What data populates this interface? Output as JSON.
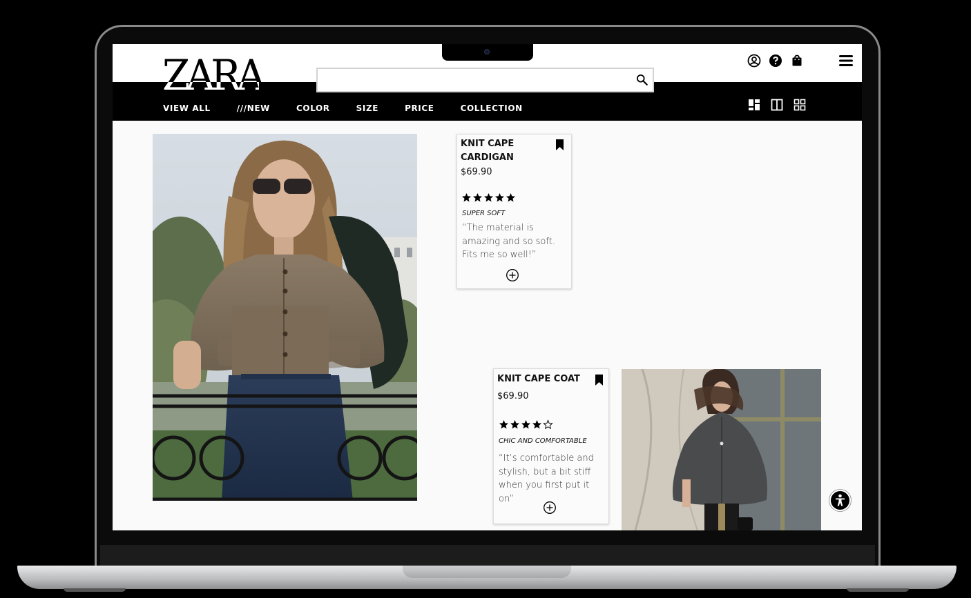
{
  "brand": {
    "logo_text": "ZARA"
  },
  "search": {
    "placeholder": "",
    "value": "",
    "icon": "search-icon"
  },
  "header_icons": [
    "account-icon",
    "help-icon",
    "shopping-bag-icon",
    "menu-icon"
  ],
  "nav": {
    "links": [
      "VIEW ALL",
      "///NEW",
      "COLOR",
      "SIZE",
      "PRICE",
      "COLLECTION"
    ],
    "view_modes": [
      "mosaic-view-icon",
      "two-column-view-icon",
      "grid-view-icon"
    ]
  },
  "products": [
    {
      "name_line1": "KNIT CAPE",
      "name_line2": "CARDIGAN",
      "price": "$69.90",
      "rating": 5,
      "rating_max": 5,
      "review_title": "SUPER SOFT",
      "review_line1": "“The material is",
      "review_line2": "amazing and so soft.",
      "review_line3": "Fits me so well!”",
      "image": "woman in taupe knit cape cardigan and jeans on balcony"
    },
    {
      "name_line1": "KNIT CAPE COAT",
      "price": "$69.90",
      "rating": 4,
      "rating_max": 5,
      "review_title": "CHIC AND COMFORTABLE",
      "review_line1": "“It’s comfortable and",
      "review_line2": "stylish, but a bit stiff",
      "review_line3": "when you first put it",
      "review_line4": "on”",
      "image": "woman in charcoal grey cape coat in front of a building"
    }
  ],
  "accessibility": {
    "icon": "accessibility-icon"
  },
  "colors": {
    "nav_bg": "#000000",
    "page_bg": "#fafafa",
    "text": "#111111"
  }
}
